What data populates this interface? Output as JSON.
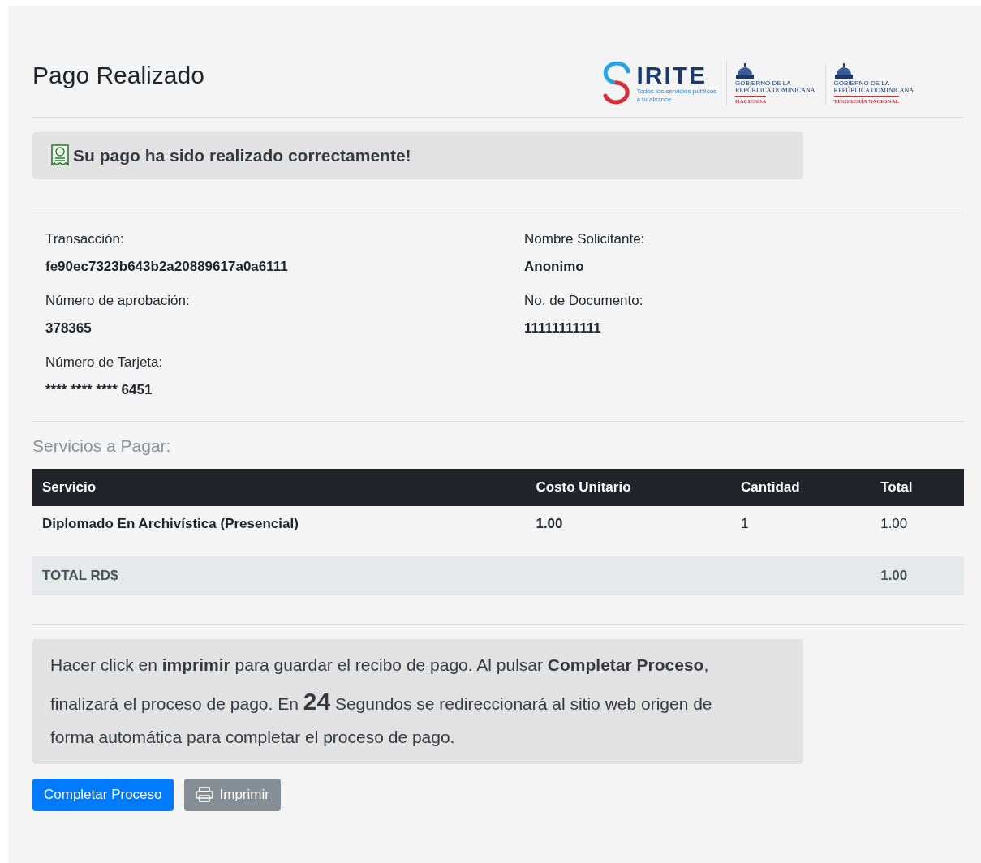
{
  "title": "Pago Realizado",
  "logos": {
    "sirite": {
      "name": "IRITE",
      "tagline": [
        "Todos los servicios públicos",
        "a tu alcance"
      ]
    },
    "gov": [
      {
        "top": "GOBIERNO DE LA",
        "country": "REPÚBLICA DOMINICANA",
        "unit": "HACIENDA"
      },
      {
        "top": "GOBIERNO DE LA",
        "country": "REPÚBLICA DOMINICANA",
        "unit": "TESORERÍA NACIONAL"
      }
    ]
  },
  "success": "Su pago ha sido realizado correctamente!",
  "details": [
    {
      "label": "Transacción:",
      "value": "fe90ec7323b643b2a20889617a0a6111"
    },
    {
      "label": "Nombre Solicitante:",
      "value": "Anonimo"
    },
    {
      "label": "Número de aprobación:",
      "value": "378365"
    },
    {
      "label": "No. de Documento:",
      "value": "11111111111"
    },
    {
      "label": "Número de Tarjeta:",
      "value": "**** **** **** 6451"
    }
  ],
  "services_heading": "Servicios a Pagar:",
  "table": {
    "columns": [
      "Servicio",
      "Costo Unitario",
      "Cantidad",
      "Total"
    ],
    "rows": [
      [
        "Diplomado En Archivística (Presencial)",
        "1.00",
        "1",
        "1.00"
      ]
    ],
    "total": {
      "label": "TOTAL RD$",
      "value": "1.00"
    }
  },
  "notice": {
    "before": "Hacer click en **imprimir** para guardar el recibo de pago. Al pulsar **Completar Proceso**, finalizará el proceso de pago. En",
    "count": "24",
    "after": "Segundos se redireccionará al sitio web origen de forma automática para completar el proceso de pago."
  },
  "buttons": [
    {
      "kind": "primary",
      "label": "Completar Proceso"
    },
    {
      "kind": "print",
      "label": "Imprimir"
    }
  ]
}
